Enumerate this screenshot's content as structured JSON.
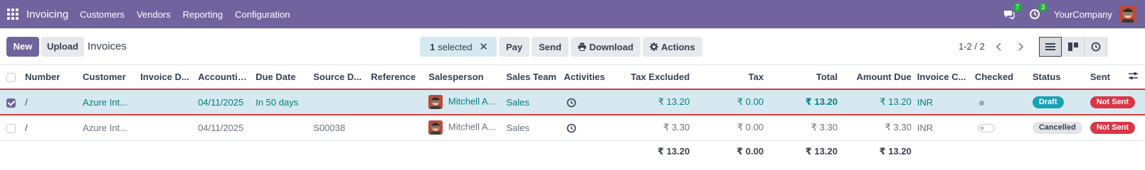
{
  "nav": {
    "app_name": "Invoicing",
    "menu": [
      "Customers",
      "Vendors",
      "Reporting",
      "Configuration"
    ],
    "messages_badge": "7",
    "activities_badge": "3",
    "company": "YourCompany"
  },
  "control": {
    "new_label": "New",
    "upload_label": "Upload",
    "breadcrumb": "Invoices",
    "selected_count": "1",
    "selected_label": "selected",
    "pay_label": "Pay",
    "send_label": "Send",
    "download_label": "Download",
    "actions_label": "Actions",
    "pager": "1-2 / 2"
  },
  "table": {
    "columns": [
      "Number",
      "Customer",
      "Invoice D...",
      "Accountin...",
      "Due Date",
      "Source D...",
      "Reference",
      "Salesperson",
      "Sales Team",
      "Activities",
      "Tax Excluded",
      "Tax",
      "Total",
      "Amount Due",
      "Invoice C...",
      "Checked",
      "Status",
      "Sent"
    ],
    "rows": [
      {
        "number": "/",
        "customer": "Azure Int...",
        "invoice_date": "",
        "accounting_date": "04/11/2025",
        "due_date": "In 50 days",
        "source": "",
        "reference": "",
        "salesperson": "Mitchell A...",
        "sales_team": "Sales",
        "tax_excluded": "₹ 13.20",
        "tax": "₹ 0.00",
        "total": "₹ 13.20",
        "amount_due": "₹ 13.20",
        "currency": "INR",
        "status": "Draft",
        "sent": "Not Sent"
      },
      {
        "number": "/",
        "customer": "Azure Int...",
        "invoice_date": "",
        "accounting_date": "04/11/2025",
        "due_date": "",
        "source": "S00038",
        "reference": "",
        "salesperson": "Mitchell A...",
        "sales_team": "Sales",
        "tax_excluded": "₹ 3.30",
        "tax": "₹ 0.00",
        "total": "₹ 3.30",
        "amount_due": "₹ 3.30",
        "currency": "INR",
        "status": "Cancelled",
        "sent": "Not Sent"
      }
    ],
    "totals": {
      "tax_excluded": "₹ 13.20",
      "tax": "₹ 0.00",
      "total": "₹ 13.20",
      "amount_due": "₹ 13.20"
    }
  },
  "colors": {
    "brand": "#71639e",
    "selected_row": "#d6e9f1",
    "draft": "#17a2b8",
    "not_sent": "#dc3545"
  }
}
